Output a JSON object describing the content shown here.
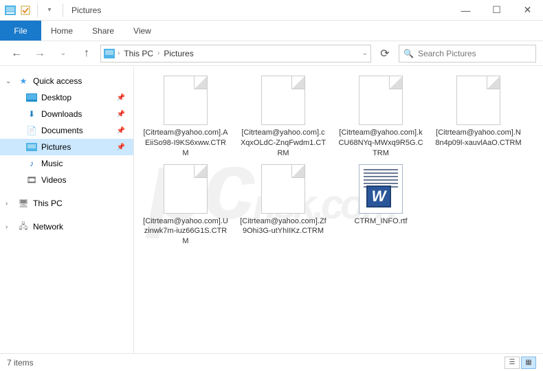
{
  "window": {
    "title": "Pictures"
  },
  "ribbon": {
    "file": "File",
    "tabs": [
      "Home",
      "Share",
      "View"
    ]
  },
  "breadcrumb": {
    "items": [
      "This PC",
      "Pictures"
    ]
  },
  "search": {
    "placeholder": "Search Pictures"
  },
  "sidebar": {
    "quick_access": "Quick access",
    "items": [
      {
        "label": "Desktop"
      },
      {
        "label": "Downloads"
      },
      {
        "label": "Documents"
      },
      {
        "label": "Pictures"
      },
      {
        "label": "Music"
      },
      {
        "label": "Videos"
      }
    ],
    "this_pc": "This PC",
    "network": "Network"
  },
  "files": [
    {
      "name": "[Citrteam@yahoo.com].AEiiSo98-I9KS6xww.CTRM",
      "type": "blank"
    },
    {
      "name": "[Citrteam@yahoo.com].cXqxOLdC-ZnqFwdm1.CTRM",
      "type": "blank"
    },
    {
      "name": "[Citrteam@yahoo.com].kCU68NYq-MWxq9R5G.CTRM",
      "type": "blank"
    },
    {
      "name": "[Citrteam@yahoo.com].N8n4p09l-xauvlAaO.CTRM",
      "type": "blank"
    },
    {
      "name": "[Citrteam@yahoo.com].Uzinwk7m-iuz66G1S.CTRM",
      "type": "blank"
    },
    {
      "name": "[Citrteam@yahoo.com].Zf9Ohi3G-utYhIIKz.CTRM",
      "type": "blank"
    },
    {
      "name": "CTRM_INFO.rtf",
      "type": "rtf"
    }
  ],
  "status": {
    "count": "7 items"
  },
  "watermark": "pcrisk.com"
}
